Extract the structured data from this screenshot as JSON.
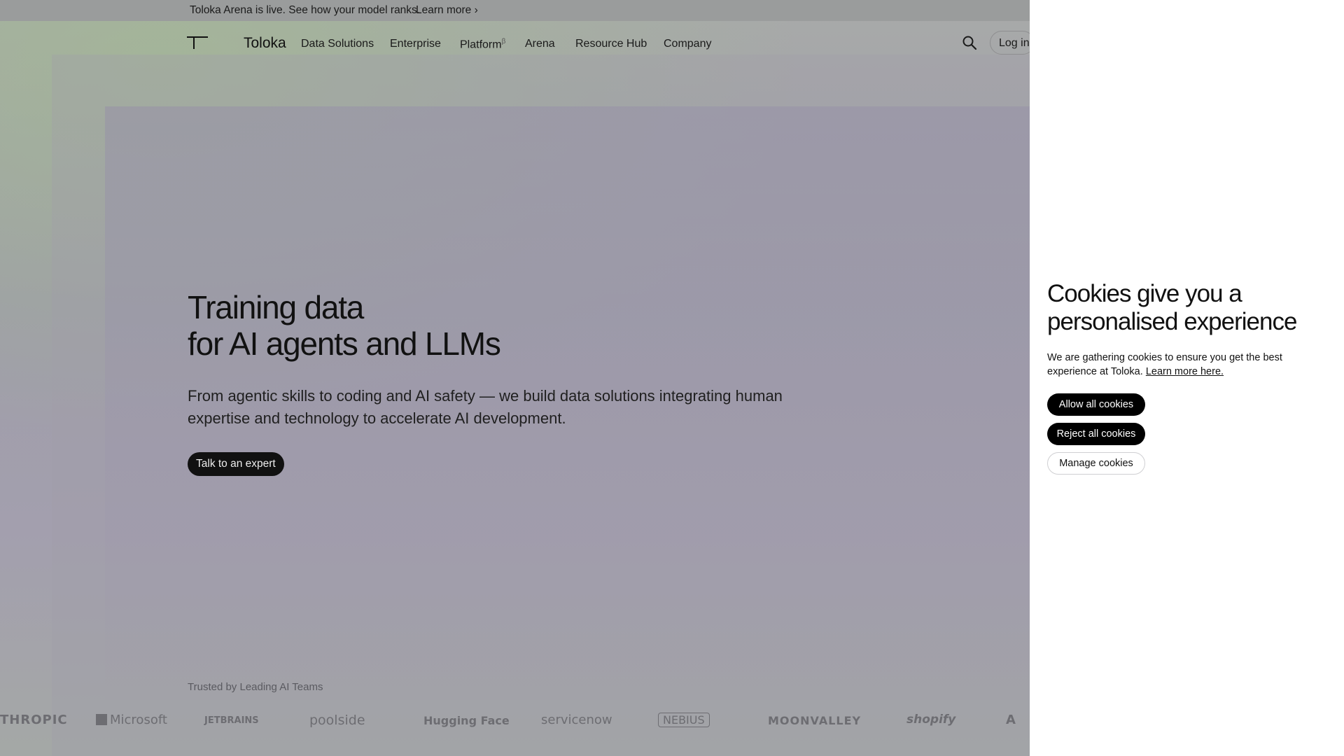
{
  "announcement": {
    "text": "Toloka Arena is live. See how your model ranks.",
    "link": "Learn more ›"
  },
  "nav": {
    "brand": "Toloka",
    "items": [
      {
        "label": "Data Solutions"
      },
      {
        "label": "Enterprise"
      },
      {
        "label": "Platform",
        "badge": "β"
      },
      {
        "label": "Arena"
      },
      {
        "label": "Resource Hub"
      },
      {
        "label": "Company"
      }
    ],
    "login": "Log in"
  },
  "hero": {
    "title_line1": "Training data",
    "title_line2": "for AI agents and LLMs",
    "subtitle": "From agentic skills to coding and AI safety — we build data solutions integrating human expertise and technology to accelerate AI development.",
    "cta": "Talk to an expert"
  },
  "trusted": {
    "label": "Trusted by Leading AI Teams",
    "logos": [
      "THROPIC",
      "Microsoft",
      "JETBRAINS",
      "poolside",
      "Hugging Face",
      "servicenow",
      "NEBIUS",
      "MOONVALLEY",
      "shopify",
      "A"
    ]
  },
  "cookies": {
    "title": "Cookies give you a personalised experience",
    "text": "We are gathering cookies to ensure you get the best experience at Toloka.",
    "link": "Learn more here.",
    "allow": "Allow all cookies",
    "reject": "Reject all cookies",
    "manage": "Manage cookies"
  }
}
